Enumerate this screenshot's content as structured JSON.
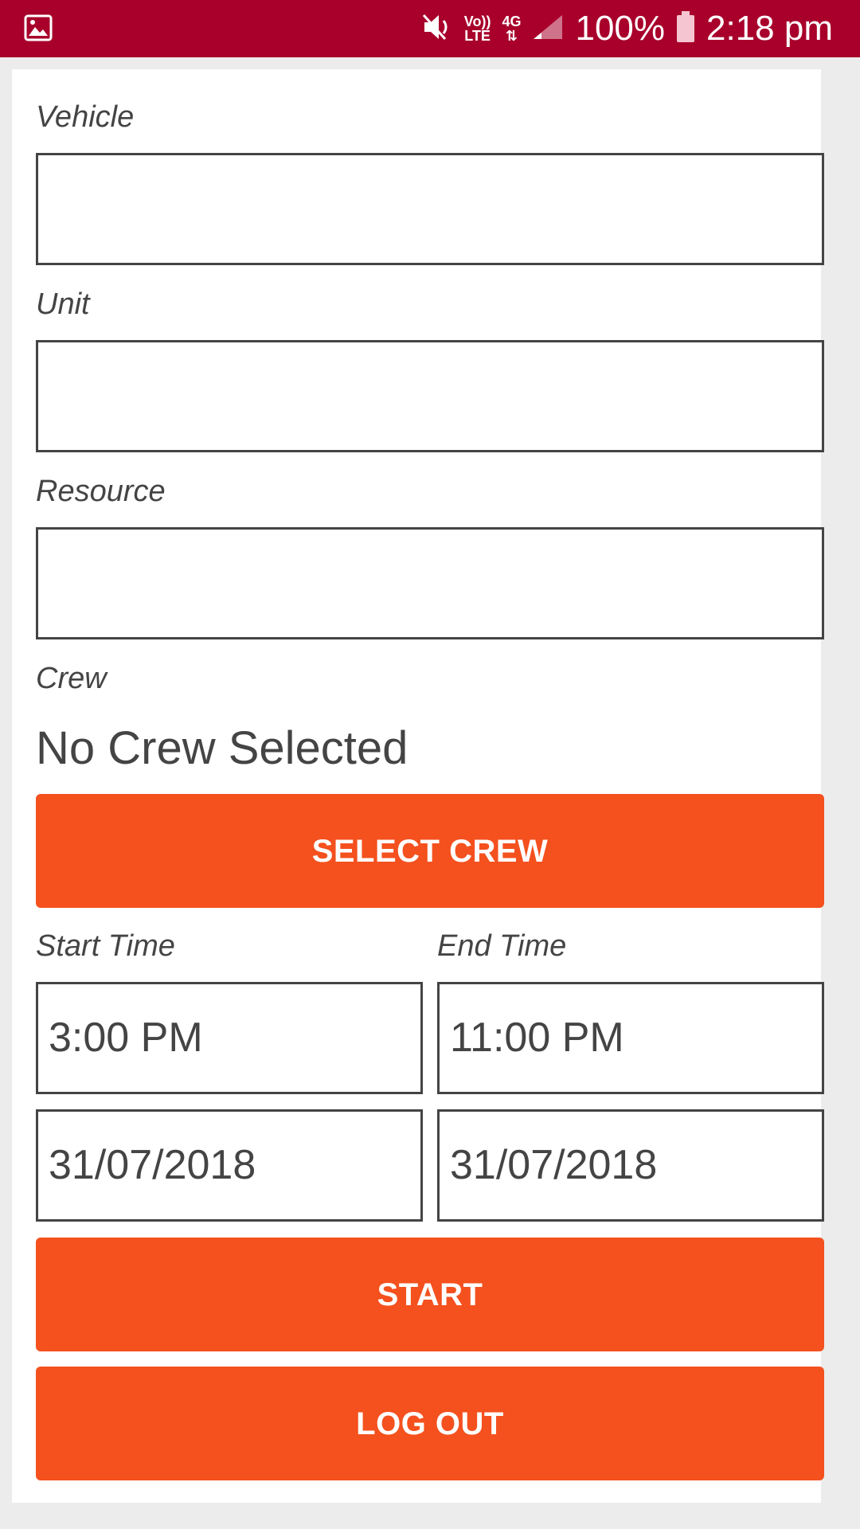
{
  "status_bar": {
    "lte_top": "Vo))",
    "lte_bottom": "LTE",
    "network": "4G",
    "battery": "100%",
    "time": "2:18 pm"
  },
  "form": {
    "vehicle": {
      "label": "Vehicle",
      "value": ""
    },
    "unit": {
      "label": "Unit",
      "value": ""
    },
    "resource": {
      "label": "Resource",
      "value": ""
    },
    "crew": {
      "label": "Crew",
      "value": "No Crew Selected"
    },
    "select_crew_label": "SELECT CREW",
    "start_time": {
      "label": "Start Time",
      "time": "3:00 PM",
      "date": "31/07/2018"
    },
    "end_time": {
      "label": "End Time",
      "time": "11:00 PM",
      "date": "31/07/2018"
    },
    "start_label": "START",
    "logout_label": "LOG OUT"
  },
  "colors": {
    "status_bar": "#a8002b",
    "accent": "#f4511e",
    "background": "#ececec"
  },
  "icons": [
    "image-icon",
    "mute-icon",
    "signal-icon",
    "battery-icon"
  ]
}
